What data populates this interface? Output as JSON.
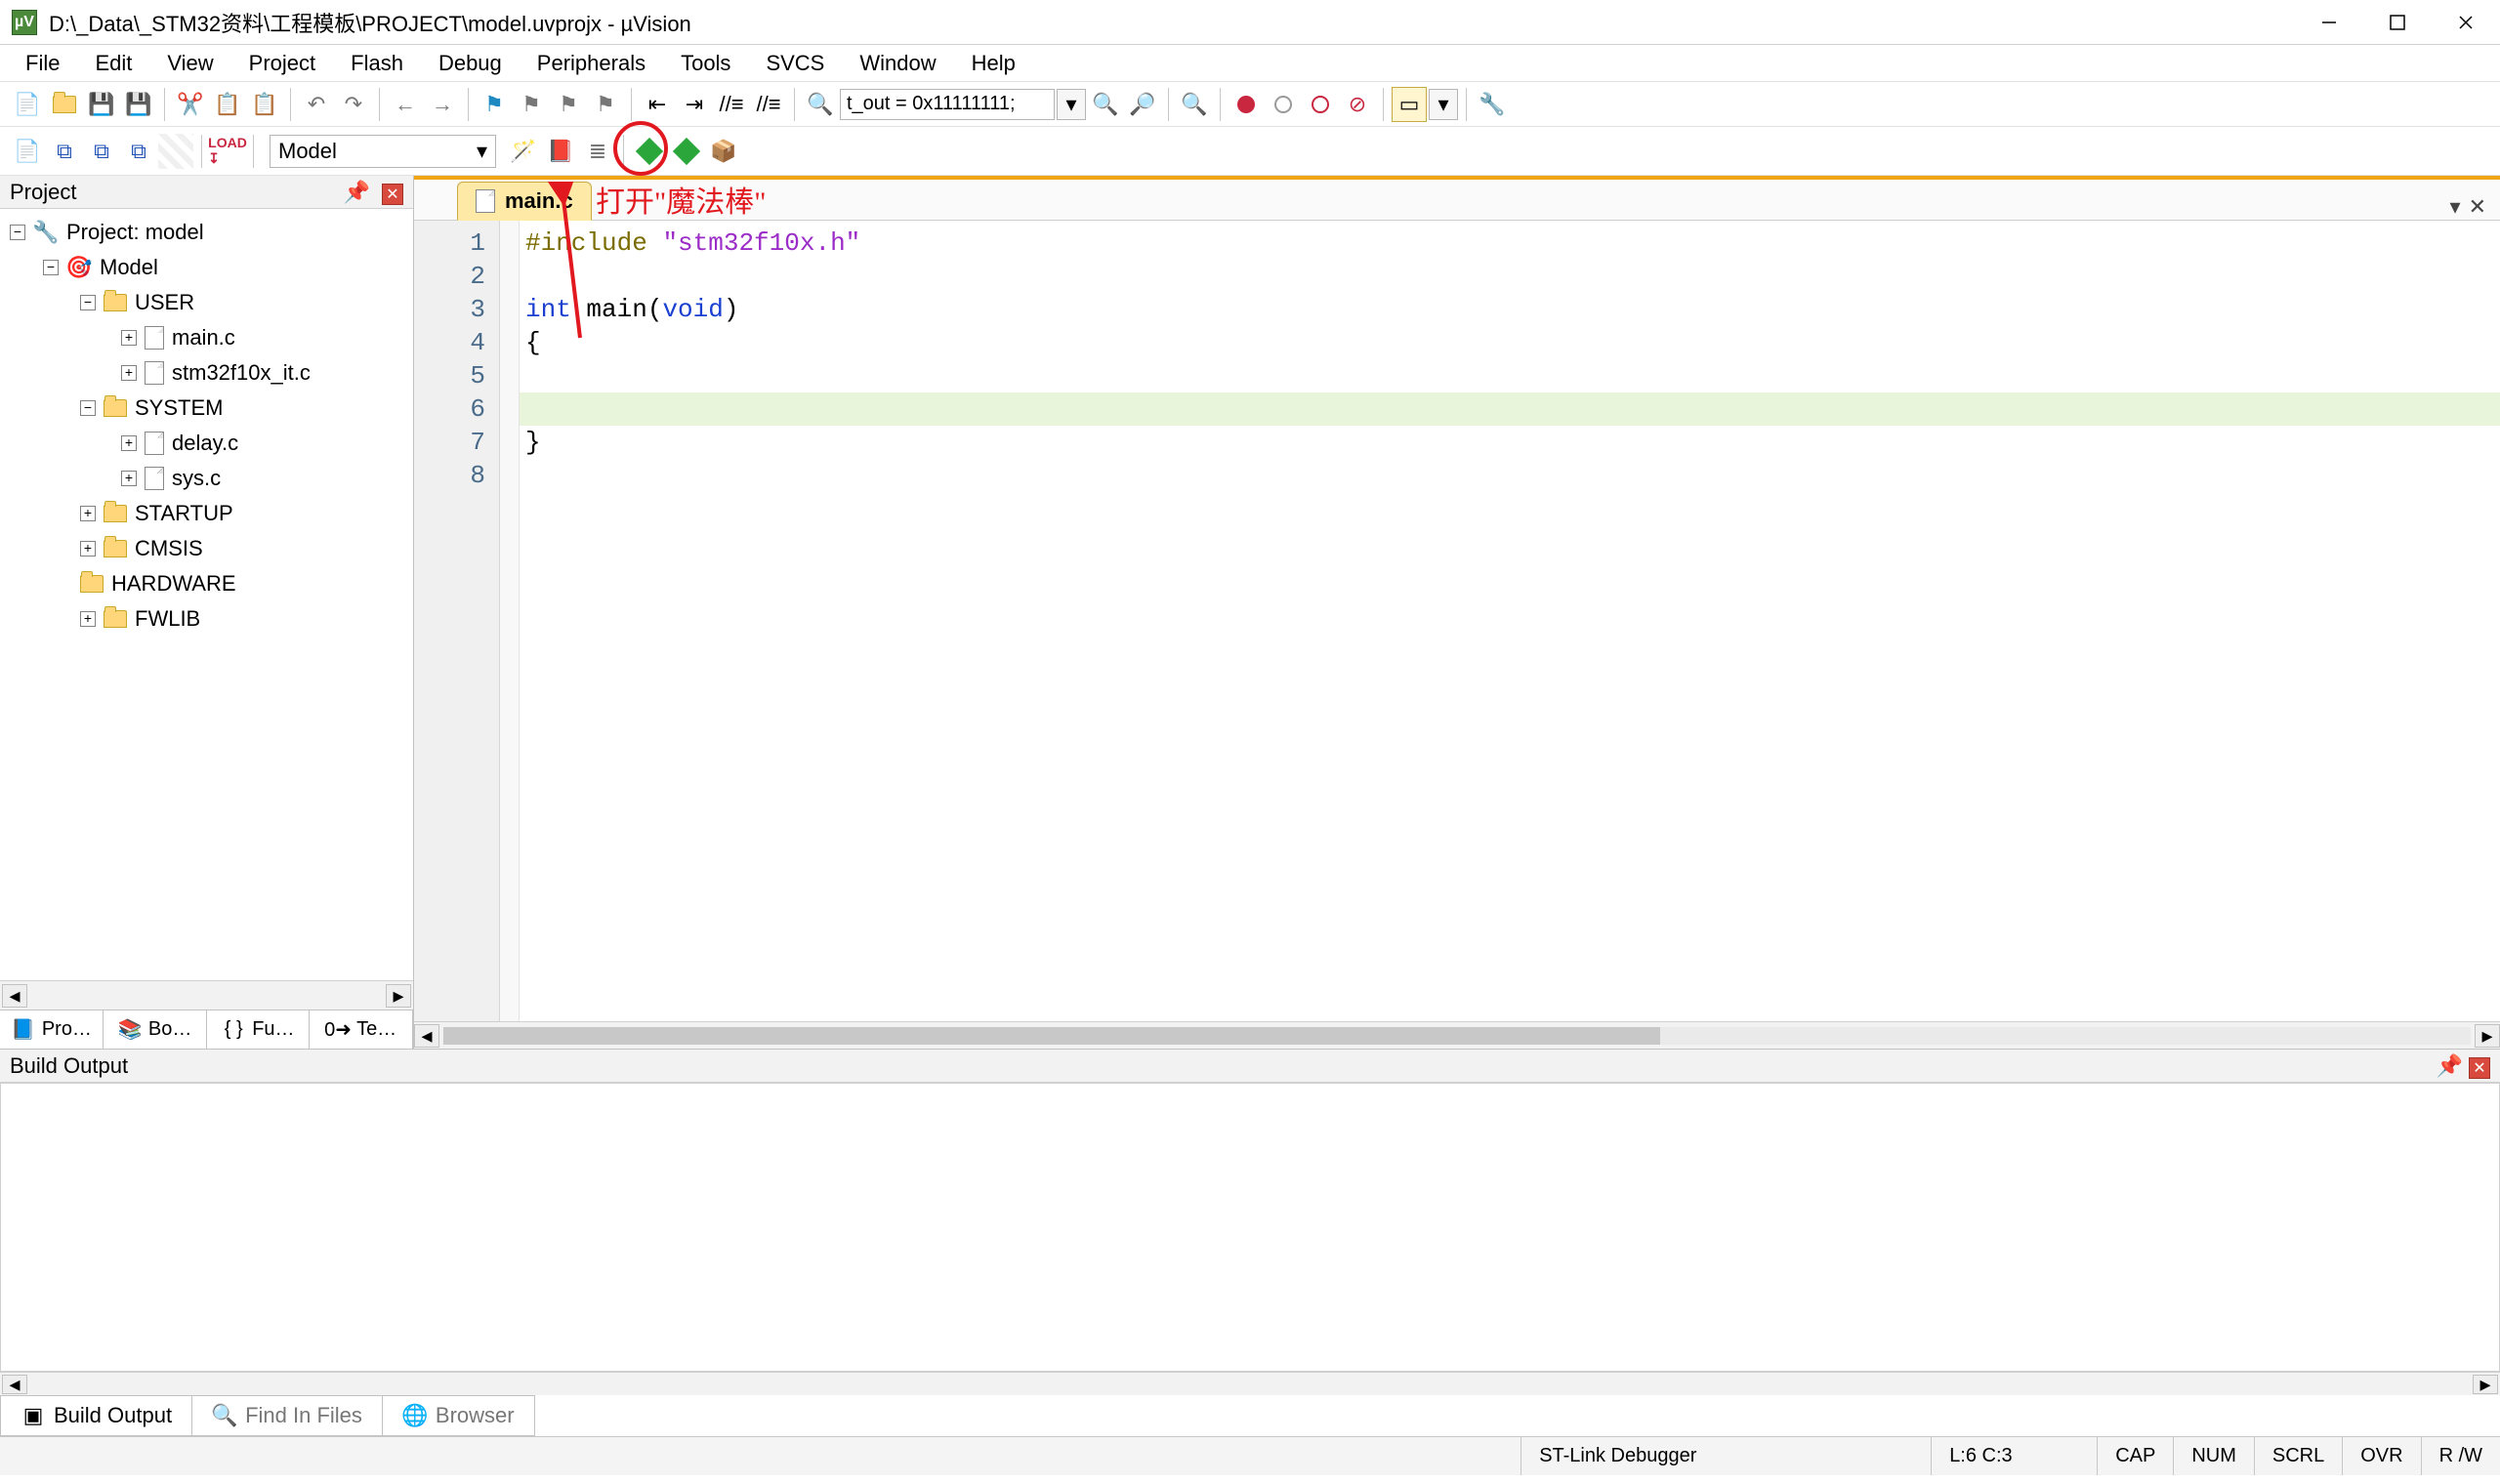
{
  "titlebar": {
    "caption": "D:\\_Data\\_STM32资料\\工程模板\\PROJECT\\model.uvprojx - µVision"
  },
  "menu": {
    "items": [
      "File",
      "Edit",
      "View",
      "Project",
      "Flash",
      "Debug",
      "Peripherals",
      "Tools",
      "SVCS",
      "Window",
      "Help"
    ]
  },
  "toolbar1": {
    "find_input": "t_out = 0x11111111;"
  },
  "toolbar2": {
    "target": "Model"
  },
  "panels": {
    "project": {
      "title": "Project"
    },
    "build": {
      "title": "Build Output"
    }
  },
  "project_tree": {
    "root": "Project: model",
    "target": "Model",
    "groups": [
      {
        "name": "USER",
        "expanded": true,
        "files": [
          "main.c",
          "stm32f10x_it.c"
        ]
      },
      {
        "name": "SYSTEM",
        "expanded": true,
        "files": [
          "delay.c",
          "sys.c"
        ]
      },
      {
        "name": "STARTUP",
        "expanded": false,
        "files": []
      },
      {
        "name": "CMSIS",
        "expanded": false,
        "files": []
      },
      {
        "name": "HARDWARE",
        "expanded": false,
        "files": []
      },
      {
        "name": "FWLIB",
        "expanded": false,
        "files": []
      }
    ]
  },
  "project_tabs": {
    "items": [
      "Pro…",
      "Bo…",
      "Fu…",
      "Te…"
    ],
    "prefixes": [
      "📘",
      "📚",
      "{ }",
      "0➜"
    ]
  },
  "editor": {
    "tabs": [
      {
        "name": "main.c",
        "active": true
      }
    ],
    "code_lines": [
      {
        "n": 1,
        "segments": [
          {
            "t": "#include ",
            "cls": "kw-pp"
          },
          {
            "t": "\"stm32f10x.h\"",
            "cls": "kw-str"
          }
        ]
      },
      {
        "n": 2,
        "segments": []
      },
      {
        "n": 3,
        "segments": [
          {
            "t": "int ",
            "cls": "kw-type"
          },
          {
            "t": "main(",
            "cls": ""
          },
          {
            "t": "void",
            "cls": "kw-type"
          },
          {
            "t": ")",
            "cls": ""
          }
        ]
      },
      {
        "n": 4,
        "segments": [
          {
            "t": "{",
            "cls": ""
          }
        ],
        "fold": "open"
      },
      {
        "n": 5,
        "segments": []
      },
      {
        "n": 6,
        "segments": [],
        "caret": true
      },
      {
        "n": 7,
        "segments": [
          {
            "t": "}",
            "cls": ""
          }
        ]
      },
      {
        "n": 8,
        "segments": []
      }
    ]
  },
  "annotation": {
    "text": "打开\"魔法棒\""
  },
  "build_tabs": {
    "items": [
      "Build Output",
      "Find In Files",
      "Browser"
    ]
  },
  "status": {
    "debugger": "ST-Link Debugger",
    "pos": "L:6 C:3",
    "indicators": [
      "CAP",
      "NUM",
      "SCRL",
      "OVR",
      "R /W"
    ]
  }
}
